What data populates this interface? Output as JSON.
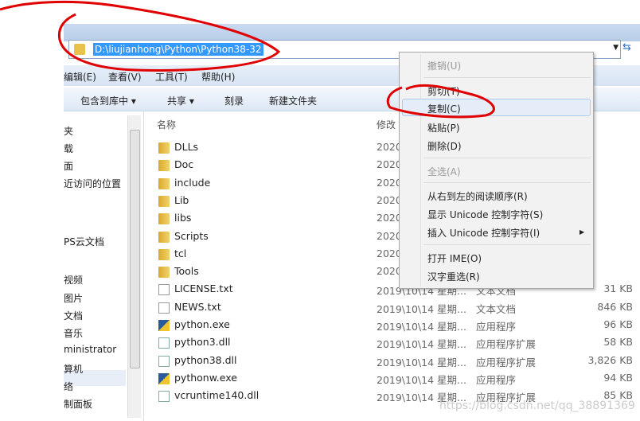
{
  "address": {
    "path": "D:\\liujianhong\\Python\\Python38-32"
  },
  "menubar": [
    "编辑(E)",
    "查看(V)",
    "工具(T)",
    "帮助(H)"
  ],
  "toolbar": [
    "包含到库中 ▾",
    "共享 ▾",
    "刻录",
    "新建文件夹"
  ],
  "nav": [
    "夹",
    "载",
    "面",
    "近访问的位置",
    "PS云文档",
    "视频",
    "图片",
    "文档",
    "音乐",
    "ministrator",
    "算机",
    "络",
    "制面板"
  ],
  "columns": {
    "name": "名称",
    "date": "修改"
  },
  "files": [
    {
      "name": "DLLs",
      "icon": "folder",
      "date": "2020",
      "type": "",
      "size": ""
    },
    {
      "name": "Doc",
      "icon": "folder",
      "date": "2020",
      "type": "",
      "size": ""
    },
    {
      "name": "include",
      "icon": "folder",
      "date": "2020",
      "type": "",
      "size": ""
    },
    {
      "name": "Lib",
      "icon": "folder",
      "date": "2020",
      "type": "",
      "size": ""
    },
    {
      "name": "libs",
      "icon": "folder",
      "date": "2020",
      "type": "",
      "size": ""
    },
    {
      "name": "Scripts",
      "icon": "folder",
      "date": "2020",
      "type": "",
      "size": ""
    },
    {
      "name": "tcl",
      "icon": "folder",
      "date": "2020",
      "type": "",
      "size": ""
    },
    {
      "name": "Tools",
      "icon": "folder",
      "date": "2020",
      "type": "",
      "size": ""
    },
    {
      "name": "LICENSE.txt",
      "icon": "file",
      "date": "2019\\10\\14 星期...",
      "type": "文本文档",
      "size": "31 KB"
    },
    {
      "name": "NEWS.txt",
      "icon": "file",
      "date": "2019\\10\\14 星期...",
      "type": "文本文档",
      "size": "846 KB"
    },
    {
      "name": "python.exe",
      "icon": "exe",
      "date": "2019\\10\\14 星期...",
      "type": "应用程序",
      "size": "96 KB"
    },
    {
      "name": "python3.dll",
      "icon": "dll",
      "date": "2019\\10\\14 星期...",
      "type": "应用程序扩展",
      "size": "58 KB"
    },
    {
      "name": "python38.dll",
      "icon": "dll",
      "date": "2019\\10\\14 星期...",
      "type": "应用程序扩展",
      "size": "3,826 KB"
    },
    {
      "name": "pythonw.exe",
      "icon": "exe",
      "date": "2019\\10\\14 星期...",
      "type": "应用程序",
      "size": "94 KB"
    },
    {
      "name": "vcruntime140.dll",
      "icon": "dll",
      "date": "2019\\10\\14 星期...",
      "type": "应用程序扩展",
      "size": "85 KB"
    }
  ],
  "context_menu": {
    "undo": "撤销(U)",
    "cut": "剪切(T)",
    "copy": "复制(C)",
    "paste": "粘贴(P)",
    "delete": "删除(D)",
    "select_all": "全选(A)",
    "rtl": "从右到左的阅读顺序(R)",
    "show_unicode": "显示 Unicode 控制字符(S)",
    "insert_unicode": "插入 Unicode 控制字符(I)",
    "open_ime": "打开 IME(O)",
    "reconversion": "汉字重选(R)"
  },
  "watermark": "https://blog.csdn.net/qq_38891369",
  "colors": {
    "selection": "#3399ff",
    "annotation": "#e00000"
  }
}
